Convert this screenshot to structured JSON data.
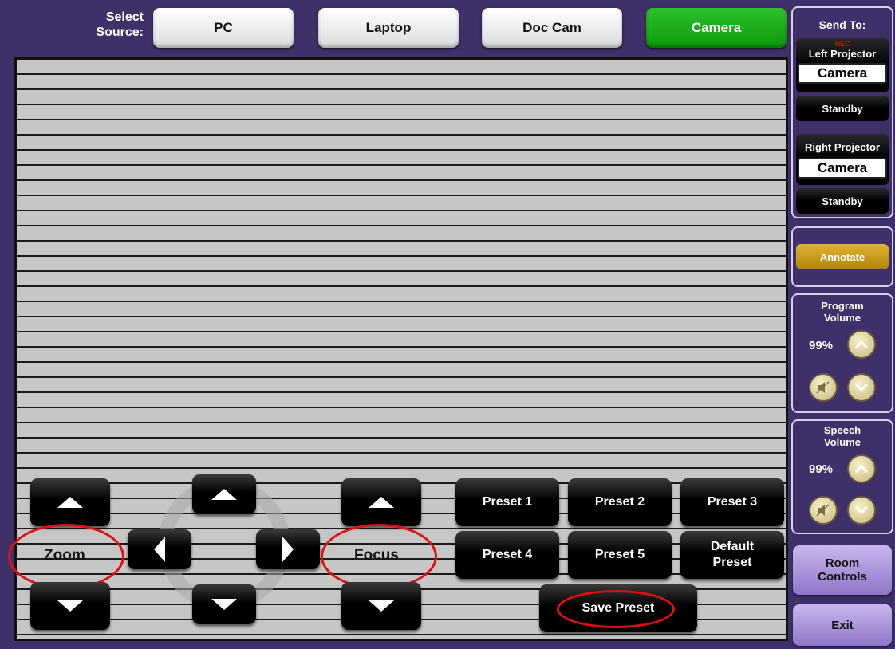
{
  "source": {
    "label_line1": "Select",
    "label_line2": "Source:",
    "buttons": [
      "PC",
      "Laptop",
      "Doc Cam",
      "Camera"
    ],
    "active": "Camera",
    "active_color": "#17ad17"
  },
  "camera": {
    "zoom_label": "Zoom",
    "focus_label": "Focus",
    "presets": [
      "Preset 1",
      "Preset 2",
      "Preset 3",
      "Preset 4",
      "Preset 5"
    ],
    "default_preset_line1": "Default",
    "default_preset_line2": "Preset",
    "save_preset": "Save Preset",
    "highlight_color": "#e01010"
  },
  "send_to": {
    "title": "Send To:",
    "rec_label": "REC",
    "left_projector": {
      "name": "Left Projector",
      "source": "Camera",
      "standby": "Standby"
    },
    "right_projector": {
      "name": "Right Projector",
      "source": "Camera",
      "standby": "Standby"
    }
  },
  "annotate": {
    "label": "Annotate",
    "color": "#c99a10"
  },
  "program_volume": {
    "line1": "Program",
    "line2": "Volume",
    "value": "99%"
  },
  "speech_volume": {
    "line1": "Speech",
    "line2": "Volume",
    "value": "99%"
  },
  "room_controls": {
    "line1": "Room",
    "line2": "Controls"
  },
  "exit": {
    "label": "Exit"
  },
  "icons": {
    "up": "arrow-up-icon",
    "down": "arrow-down-icon",
    "left": "arrow-left-icon",
    "right": "arrow-right-icon",
    "mute": "speaker-mute-icon",
    "vol_up": "chevron-up-icon",
    "vol_down": "chevron-down-icon"
  }
}
